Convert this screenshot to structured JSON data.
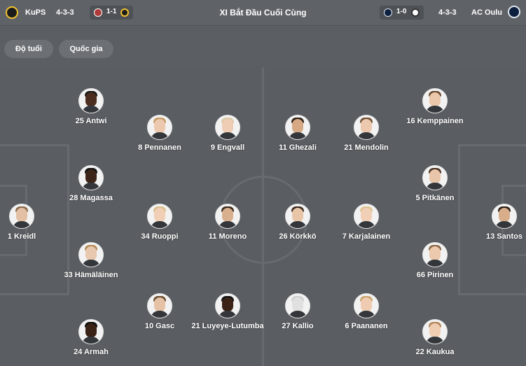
{
  "header": {
    "title": "XI Bắt Đầu Cuối Cùng",
    "home": {
      "name": "KuPS",
      "formation": "4-3-3",
      "last_result": "1-1"
    },
    "away": {
      "name": "AC Oulu",
      "formation": "4-3-3",
      "last_result": "1-0"
    }
  },
  "filters": {
    "age": "Độ tuổi",
    "nationality": "Quốc gia"
  },
  "players": [
    {
      "name": "25 Antwi",
      "skin": "#4b2e20",
      "hair": "#1a1a1a"
    },
    {
      "name": "28 Magassa",
      "skin": "#3d2418",
      "hair": "#121212"
    },
    {
      "name": "33 Hämäläinen",
      "skin": "#e8c8ae",
      "hair": "#b48a55"
    },
    {
      "name": "24 Armah",
      "skin": "#3a2216",
      "hair": "#111111"
    },
    {
      "name": "1 Kreidl",
      "skin": "#e3c0a4",
      "hair": "#8a6a4a"
    },
    {
      "name": "8 Pennanen",
      "skin": "#ecc8ae",
      "hair": "#c79a62"
    },
    {
      "name": "34 Ruoppi",
      "skin": "#f0cfb6",
      "hair": "#d8c08a"
    },
    {
      "name": "10 Gasc",
      "skin": "#e5c2a6",
      "hair": "#6b4c30"
    },
    {
      "name": "9 Engvall",
      "skin": "#efcdb5",
      "hair": "#d9c9a8"
    },
    {
      "name": "11 Moreno",
      "skin": "#d9b08e",
      "hair": "#3a2a1c"
    },
    {
      "name": "21 Luyeye-Lutumba",
      "skin": "#3b2318",
      "hair": "#121212"
    },
    {
      "name": "11 Ghezali",
      "skin": "#d6a984",
      "hair": "#2a1d14"
    },
    {
      "name": "26 Körkkö",
      "skin": "#e9c5a8",
      "hair": "#3c2a1e"
    },
    {
      "name": "27 Kallio",
      "skin": "#e0e0e0",
      "hair": "#cfcfcf"
    },
    {
      "name": "21 Mendolin",
      "skin": "#ecc9ae",
      "hair": "#6e4e33"
    },
    {
      "name": "7 Karjalainen",
      "skin": "#f1cfb6",
      "hair": "#dcc592"
    },
    {
      "name": "6 Paananen",
      "skin": "#efcbb1",
      "hair": "#c9a46c"
    },
    {
      "name": "16 Kemppainen",
      "skin": "#ebc7ab",
      "hair": "#6a4b31"
    },
    {
      "name": "5 Pitkänen",
      "skin": "#e9c5aa",
      "hair": "#4a3424"
    },
    {
      "name": "66 Pirinen",
      "skin": "#ecc8ac",
      "hair": "#8a6643"
    },
    {
      "name": "22 Kaukua",
      "skin": "#efcdb2",
      "hair": "#b38658"
    },
    {
      "name": "13 Santos",
      "skin": "#d8ad8a",
      "hair": "#2c1f16"
    }
  ],
  "colors": {
    "background": "#595d61",
    "pitch_lines": "#676b6f",
    "chip": "#6c7074"
  }
}
